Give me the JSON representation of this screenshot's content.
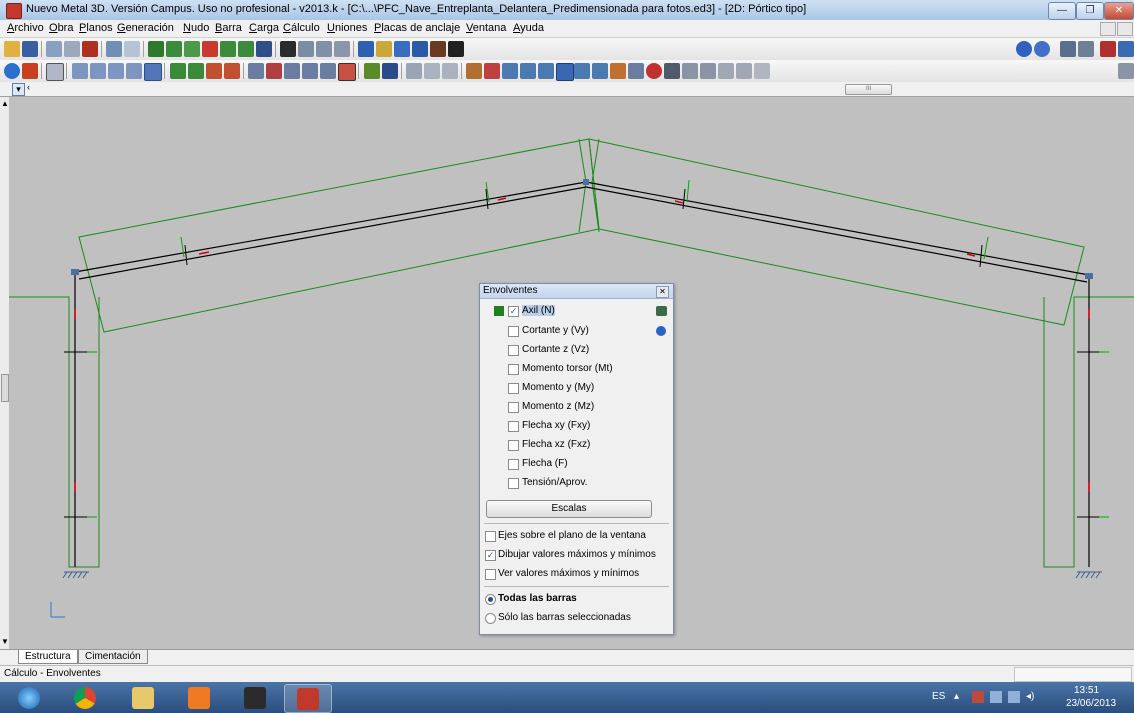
{
  "window": {
    "title": "Nuevo Metal 3D. Versión Campus. Uso no profesional - v2013.k - [C:\\...\\PFC_Nave_Entreplanta_Delantera_Predimensionada para fotos.ed3] - [2D: Pórtico tipo]"
  },
  "menu": [
    "Archivo",
    "Obra",
    "Planos",
    "Generación",
    "Nudo",
    "Barra",
    "Carga",
    "Cálculo",
    "Uniones",
    "Placas de anclaje",
    "Ventana",
    "Ayuda"
  ],
  "colors": {
    "structure": "#1a8a1a",
    "bars": "#000000",
    "axes": "#00aa00",
    "accent_red": "#d40000",
    "checked_green": "#1d7f1d"
  },
  "view": {
    "scroll_thumb_label": "III"
  },
  "dialog": {
    "title": "Envolventes",
    "options": [
      {
        "label": "Axil (N)",
        "checked": true
      },
      {
        "label": "Cortante y (Vy)",
        "checked": false
      },
      {
        "label": "Cortante z (Vz)",
        "checked": false
      },
      {
        "label": "Momento torsor (Mt)",
        "checked": false
      },
      {
        "label": "Momento y (My)",
        "checked": false
      },
      {
        "label": "Momento z (Mz)",
        "checked": false
      },
      {
        "label": "Flecha xy (Fxy)",
        "checked": false
      },
      {
        "label": "Flecha xz (Fxz)",
        "checked": false
      },
      {
        "label": "Flecha (F)",
        "checked": false
      },
      {
        "label": "Tensión/Aprov.",
        "checked": false
      }
    ],
    "scales_button": "Escalas",
    "checks": [
      {
        "label": "Ejes sobre el plano de la ventana",
        "checked": false
      },
      {
        "label": "Dibujar valores máximos y mínimos",
        "checked": true
      },
      {
        "label": "Ver valores máximos y mínimos",
        "checked": false
      }
    ],
    "radios": [
      {
        "label": "Todas las barras",
        "selected": true
      },
      {
        "label": "Sólo las barras seleccionadas",
        "selected": false
      }
    ]
  },
  "tabs": [
    "Estructura",
    "Cimentación"
  ],
  "status": {
    "text": "Cálculo - Envolventes"
  },
  "taskbar": {
    "lang": "ES",
    "time": "13:51",
    "date": "23/06/2013"
  }
}
